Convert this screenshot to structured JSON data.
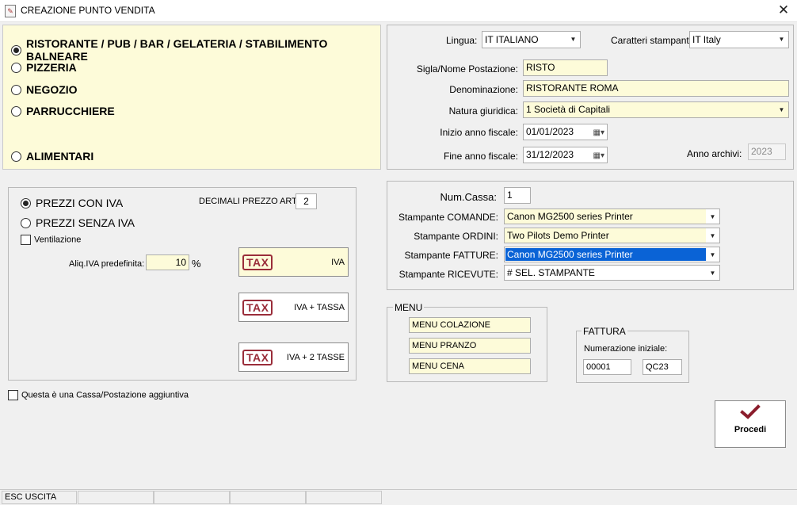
{
  "window": {
    "title": "CREAZIONE PUNTO VENDITA",
    "close_glyph": "✕"
  },
  "activity": {
    "options": [
      {
        "label": "RISTORANTE / PUB / BAR / GELATERIA / STABILIMENTO BALNEARE",
        "selected": true
      },
      {
        "label": "PIZZERIA",
        "selected": false
      },
      {
        "label": "NEGOZIO",
        "selected": false
      },
      {
        "label": "PARRUCCHIERE",
        "selected": false
      },
      {
        "label": "ALIMENTARI",
        "selected": false
      }
    ]
  },
  "company": {
    "lingua_label": "Lingua:",
    "lingua_value": "IT ITALIANO",
    "caratteri_label": "Caratteri stampante:",
    "caratteri_value": "IT Italy",
    "sigla_label": "Sigla/Nome Postazione:",
    "sigla_value": "RISTO",
    "denominazione_label": "Denominazione:",
    "denominazione_value": "RISTORANTE ROMA",
    "natura_label": "Natura giuridica:",
    "natura_value": "1  Società  di Capitali",
    "inizio_label": "Inizio anno fiscale:",
    "inizio_value": "01/01/2023",
    "fine_label": "Fine anno fiscale:",
    "fine_value": "31/12/2023",
    "archivi_label": "Anno archivi:",
    "archivi_value": "2023"
  },
  "pricing": {
    "con_iva_label": "PREZZI CON IVA",
    "con_iva_selected": true,
    "senza_iva_label": "PREZZI SENZA IVA",
    "decimali_label": "DECIMALI PREZZO ART.",
    "decimali_value": "2",
    "ventilazione_label": "Ventilazione",
    "aliq_label": "Aliq.IVA predefinita:",
    "aliq_value": "10",
    "aliq_unit": "%",
    "tax_logo": "TAX",
    "tax_buttons": [
      "IVA",
      "IVA + TASSA",
      "IVA + 2 TASSE"
    ]
  },
  "cassa": {
    "aggiuntiva_label": "Questa è una Cassa/Postazione aggiuntiva"
  },
  "printers": {
    "numcassa_label": "Num.Cassa:",
    "numcassa_value": "1",
    "comande_label": "Stampante COMANDE:",
    "comande_value": "Canon MG2500 series Printer",
    "ordini_label": "Stampante ORDINI:",
    "ordini_value": "Two Pilots Demo Printer",
    "fatture_label": "Stampante FATTURE:",
    "fatture_value": "Canon MG2500 series Printer",
    "ricevute_label": "Stampante RICEVUTE:",
    "ricevute_value": "# SEL. STAMPANTE"
  },
  "menu": {
    "title": "MENU",
    "items": [
      "MENU COLAZIONE",
      "MENU PRANZO",
      "MENU CENA"
    ]
  },
  "fattura": {
    "title": "FATTURA",
    "numerazione_label": "Numerazione iniziale:",
    "numero_value": "00001",
    "serie_value": "QC23"
  },
  "procedi": {
    "label": "Procedi",
    "icon": "checkmark-icon",
    "icon_color": "#8b1d2c"
  },
  "statusbar": {
    "esc_label": "ESC USCITA"
  },
  "colors": {
    "yellow_field": "#fdfbd9",
    "selection_blue": "#0a63d6",
    "tax_red": "#9a2d3a"
  }
}
